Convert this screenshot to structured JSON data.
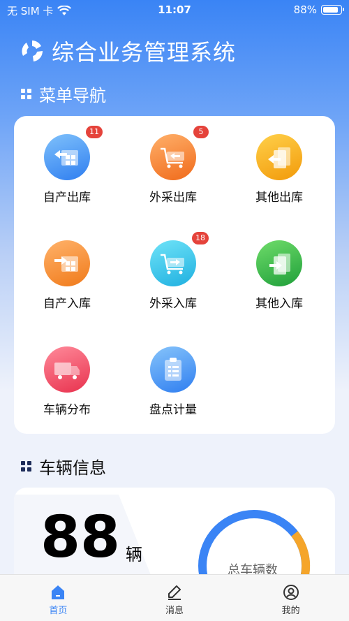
{
  "status_bar": {
    "carrier": "无 SIM 卡",
    "time": "11:07",
    "battery_text": "88%",
    "battery_level": 0.88,
    "icons": [
      "wifi-icon",
      "battery-icon"
    ]
  },
  "header": {
    "title": "综合业务管理系统",
    "logo_icon": "logo-icon"
  },
  "menu_section": {
    "title": "菜单导航"
  },
  "menu_items": [
    {
      "label": "自产出库",
      "badge": "11",
      "icon": "warehouse-out-icon",
      "color": "#3a8ef5"
    },
    {
      "label": "外采出库",
      "badge": "5",
      "icon": "cart-out-icon",
      "color": "#f5832a"
    },
    {
      "label": "其他出库",
      "badge": "",
      "icon": "docs-out-icon",
      "color": "#f5a815"
    },
    {
      "label": "自产入库",
      "badge": "",
      "icon": "warehouse-in-icon",
      "color": "#f58a2a"
    },
    {
      "label": "外采入库",
      "badge": "18",
      "icon": "cart-in-icon",
      "color": "#2ec4e8"
    },
    {
      "label": "其他入库",
      "badge": "",
      "icon": "docs-in-icon",
      "color": "#2fb64a"
    },
    {
      "label": "车辆分布",
      "badge": "",
      "icon": "truck-icon",
      "color": "#f0506a"
    },
    {
      "label": "盘点计量",
      "badge": "",
      "icon": "clipboard-icon",
      "color": "#3a8ef5"
    }
  ],
  "vehicle_section": {
    "title": "车辆信息"
  },
  "vehicle_info": {
    "count": "88",
    "unit": "辆",
    "donut_label": "总车辆数"
  },
  "tabs": [
    {
      "label": "首页",
      "icon": "home-icon",
      "active": true
    },
    {
      "label": "消息",
      "icon": "pen-icon",
      "active": false
    },
    {
      "label": "我的",
      "icon": "profile-icon",
      "active": false
    }
  ],
  "colors": {
    "accent": "#3a84f5",
    "badge": "#e5433b",
    "section_icon": "#1e2d5a"
  }
}
